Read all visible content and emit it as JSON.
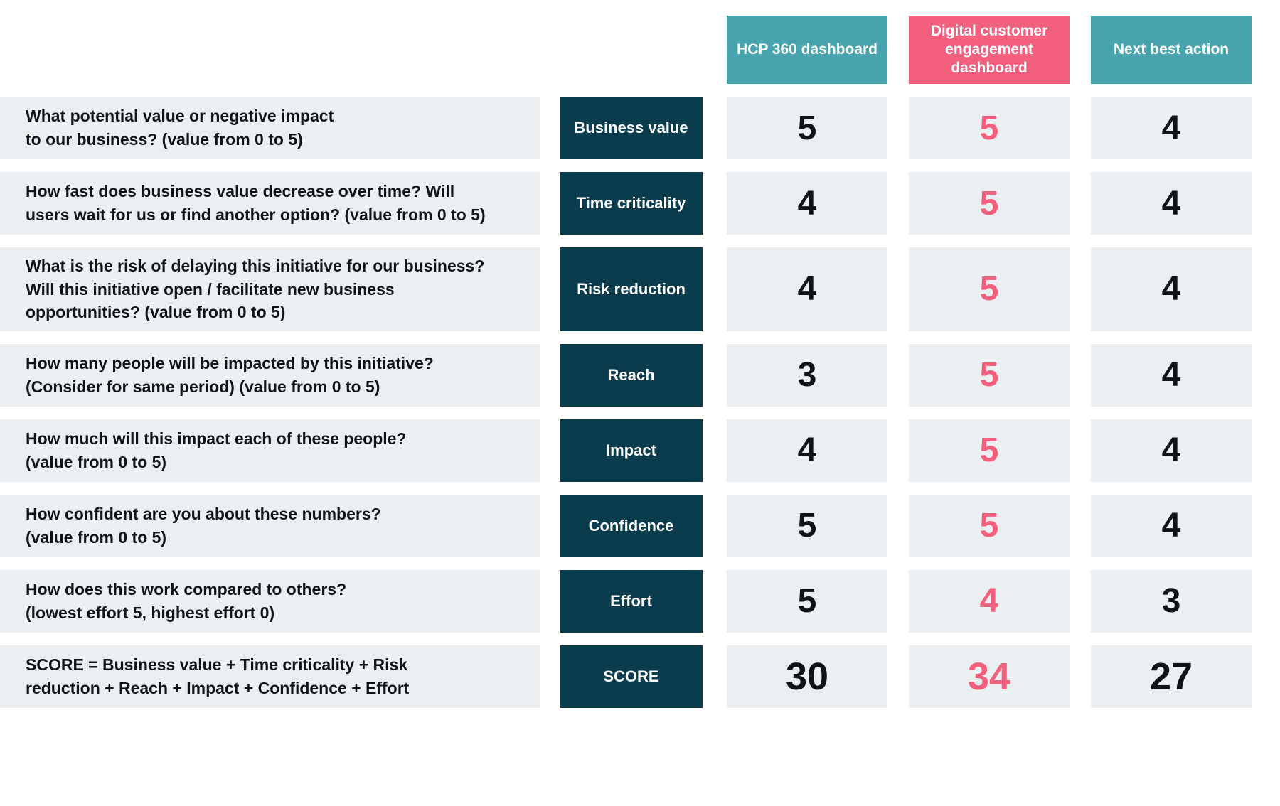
{
  "columns": [
    {
      "label": "HCP 360\ndashboard",
      "color": "#47a3ad",
      "value_color": "#101418"
    },
    {
      "label": "Digital customer\nengagement\ndashboard",
      "color": "#f2607e",
      "value_color": "#f2607e"
    },
    {
      "label": "Next\nbest action",
      "color": "#47a3ad",
      "value_color": "#101418"
    }
  ],
  "rows": [
    {
      "question": "What potential value or negative impact\nto our business? (value from 0 to 5)",
      "criterion": "Business\nvalue",
      "values": [
        "5",
        "5",
        "4"
      ]
    },
    {
      "question": "How fast does business value decrease over time? Will\nusers wait for us or find another option? (value from 0 to 5)",
      "criterion": "Time\ncriticality",
      "values": [
        "4",
        "5",
        "4"
      ]
    },
    {
      "question": "What is the risk of delaying this initiative for our business?\nWill this initiative open / facilitate new business\nopportunities? (value from 0 to 5)",
      "criterion": "Risk\nreduction",
      "values": [
        "4",
        "5",
        "4"
      ]
    },
    {
      "question": "How many people will be impacted by this initiative?\n(Consider for same period) (value from 0 to 5)",
      "criterion": "Reach",
      "values": [
        "3",
        "5",
        "4"
      ]
    },
    {
      "question": "How much will this impact each of these people?\n(value from 0 to 5)",
      "criterion": "Impact",
      "values": [
        "4",
        "5",
        "4"
      ]
    },
    {
      "question": "How confident are you about these numbers?\n(value from 0 to 5)",
      "criterion": "Confidence",
      "values": [
        "5",
        "5",
        "4"
      ]
    },
    {
      "question": "How does this work compared to others?\n(lowest effort 5, highest effort 0)",
      "criterion": "Effort",
      "values": [
        "5",
        "4",
        "3"
      ]
    },
    {
      "question": "SCORE = Business value + Time criticality + Risk\nreduction + Reach + Impact + Confidence + Effort",
      "criterion": "SCORE",
      "values": [
        "30",
        "34",
        "27"
      ]
    }
  ],
  "chart_data": {
    "type": "table",
    "title": "",
    "categories": [
      "Business value",
      "Time criticality",
      "Risk reduction",
      "Reach",
      "Impact",
      "Confidence",
      "Effort",
      "SCORE"
    ],
    "series": [
      {
        "name": "HCP 360 dashboard",
        "values": [
          5,
          4,
          4,
          3,
          4,
          5,
          5,
          30
        ]
      },
      {
        "name": "Digital customer engagement dashboard",
        "values": [
          5,
          5,
          5,
          5,
          5,
          5,
          4,
          34
        ]
      },
      {
        "name": "Next best action",
        "values": [
          4,
          4,
          4,
          4,
          4,
          4,
          3,
          27
        ]
      }
    ],
    "scale": [
      0,
      5
    ],
    "highlighted_series": "Digital customer engagement dashboard",
    "xlabel": "",
    "ylabel": "",
    "legend": "top"
  }
}
